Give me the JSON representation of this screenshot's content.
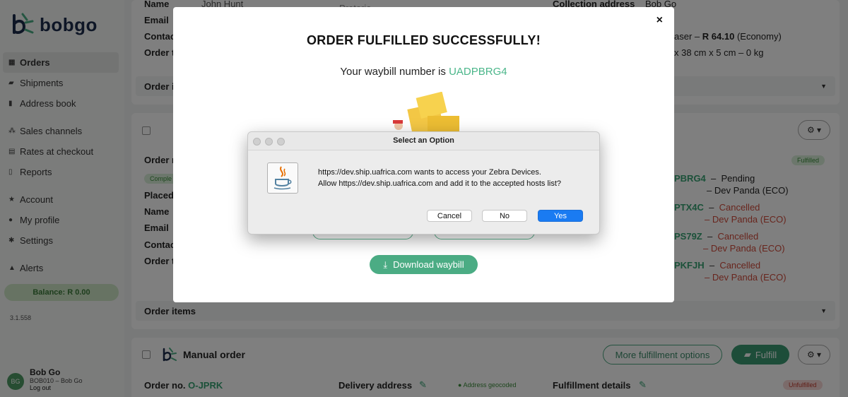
{
  "app": {
    "logo_text": "bobgo"
  },
  "sidebar": {
    "items": [
      {
        "label": "Orders",
        "icon": "inbox-icon",
        "glyph": "▦"
      },
      {
        "label": "Shipments",
        "icon": "truck-icon",
        "glyph": "▰"
      },
      {
        "label": "Address book",
        "icon": "address-book-icon",
        "glyph": "▮"
      },
      {
        "label": "Sales channels",
        "icon": "sales-channels-icon",
        "glyph": "⁂"
      },
      {
        "label": "Rates at checkout",
        "icon": "rates-icon",
        "glyph": "▤"
      },
      {
        "label": "Reports",
        "icon": "reports-icon",
        "glyph": "▯"
      },
      {
        "label": "Account",
        "icon": "star-icon",
        "glyph": "★"
      },
      {
        "label": "My profile",
        "icon": "user-icon",
        "glyph": "●"
      },
      {
        "label": "Settings",
        "icon": "gear-icon",
        "glyph": "✱"
      },
      {
        "label": "Alerts",
        "icon": "bell-icon",
        "glyph": "▲"
      }
    ],
    "balance": "Balance: R 0.00",
    "version": "3.1.558",
    "user": {
      "initials": "BG",
      "name": "Bob Go",
      "account": "BOB010 – Bob Go",
      "logout": "Log out"
    }
  },
  "background": {
    "order1": {
      "name_value": "John Hunt",
      "province_value": "Pretoria",
      "labels": [
        "Name",
        "Email",
        "Contac",
        "Order t"
      ],
      "collection_label": "Collection address",
      "collection_value": "Bob Go",
      "courier_prefix": "aser –",
      "courier_price": "R 64.10",
      "courier_service": "(Economy)",
      "parcel": "x 38 cm x 5 cm – 0 kg",
      "items_bar": "Order i"
    },
    "order2": {
      "order_label": "Order n",
      "status_chip": "Comple",
      "labels": [
        "Placed",
        "Name",
        "Email",
        "Contac",
        "Order t"
      ],
      "fulfilled_badge": "Fulfilled",
      "waybills": [
        {
          "code": "PBRG4",
          "status": "Pending",
          "carrier": "Dev Panda (ECO)",
          "state": "ok"
        },
        {
          "code": "PTX4C",
          "status": "Cancelled",
          "carrier": "Dev Panda (ECO)",
          "state": "cancelled"
        },
        {
          "code": "PS79Z",
          "status": "Cancelled",
          "carrier": "Dev Panda (ECO)",
          "state": "cancelled"
        },
        {
          "code": "PKFJH",
          "status": "Cancelled",
          "carrier": "Dev Panda (ECO)",
          "state": "cancelled"
        }
      ],
      "items_bar": "Order items"
    },
    "order3": {
      "title": "Manual order",
      "more_options": "More fulfillment options",
      "fulfill": "Fulfill",
      "order_no_label": "Order no.",
      "order_no_value": "O-JPRK",
      "delivery_label": "Delivery address",
      "geocoded": "Address geocoded",
      "fulfillment_label": "Fulfillment details",
      "unfulfilled_badge": "Unfulfilled"
    }
  },
  "modal": {
    "close": "×",
    "title": "ORDER FULFILLED SUCCESSFULLY!",
    "waybill_prefix": "Your waybill number is",
    "waybill_number": "UADPBRG4",
    "download_label": "Download waybill"
  },
  "dialog": {
    "title": "Select an Option",
    "message_line1": "https://dev.ship.uafrica.com wants to access your Zebra Devices.",
    "message_line2": "Allow https://dev.ship.uafrica.com and add it to the accepted hosts list?",
    "cancel": "Cancel",
    "no": "No",
    "yes": "Yes"
  },
  "colors": {
    "brand_green": "#4bac84",
    "accent_blue": "#1a7bf2",
    "cancelled_red": "#d04b3b"
  }
}
